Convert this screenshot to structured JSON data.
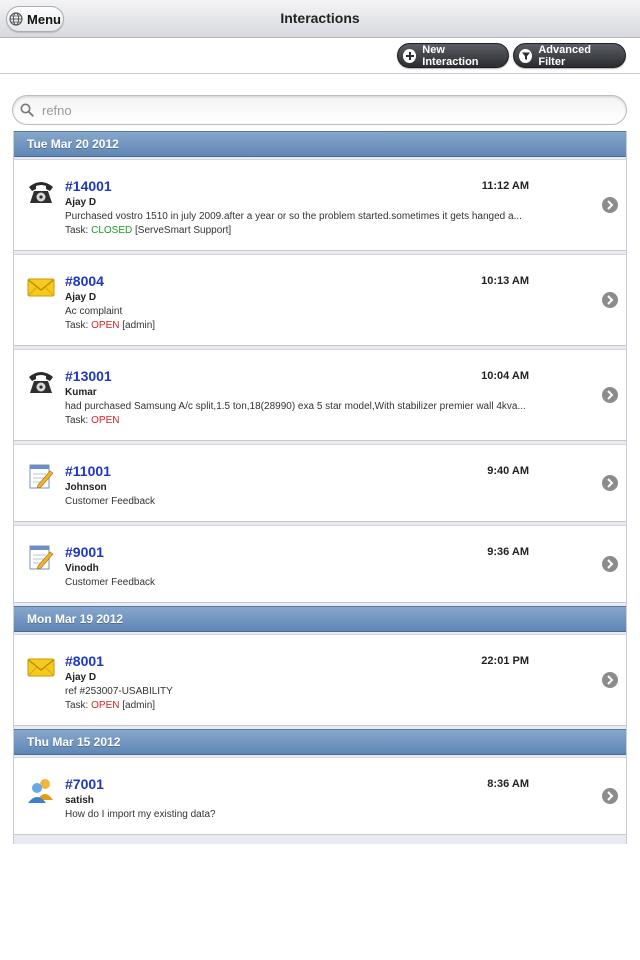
{
  "header": {
    "menu_label": "Menu",
    "title": "Interactions"
  },
  "toolbar": {
    "new_label": "New Interaction",
    "filter_label": "Advanced Filter"
  },
  "search": {
    "placeholder": "refno",
    "value": ""
  },
  "colors": {
    "accent": "#1f36c2",
    "closed": "#1b9a28",
    "open": "#e01e1e",
    "header_blue": "#6b8fbd"
  },
  "groups": [
    {
      "date": "Tue Mar 20 2012",
      "items": [
        {
          "icon": "phone-icon",
          "id": "#14001",
          "time": "11:12 AM",
          "name": "Ajay D",
          "desc": "Purchased vostro 1510 in july 2009.after a year or so the problem started.sometimes it gets hanged a...",
          "task_prefix": "Task: ",
          "status": "CLOSED",
          "task_suffix": " [ServeSmart Support]"
        },
        {
          "icon": "envelope-icon",
          "id": "#8004",
          "time": "10:13 AM",
          "name": "Ajay D",
          "desc": "Ac complaint",
          "task_prefix": "Task: ",
          "status": "OPEN",
          "task_suffix": " [admin]"
        },
        {
          "icon": "phone-icon",
          "id": "#13001",
          "time": "10:04 AM",
          "name": "Kumar",
          "desc": "had purchased Samsung A/c split,1.5 ton,18(28990) exa 5 star model,With stabilizer premier wall 4kva...",
          "task_prefix": "Task: ",
          "status": "OPEN",
          "task_suffix": ""
        },
        {
          "icon": "note-icon",
          "id": "#11001",
          "time": "9:40 AM",
          "name": "Johnson",
          "desc": "Customer Feedback"
        },
        {
          "icon": "note-icon",
          "id": "#9001",
          "time": "9:36 AM",
          "name": "Vinodh",
          "desc": "Customer Feedback"
        }
      ]
    },
    {
      "date": "Mon Mar 19 2012",
      "items": [
        {
          "icon": "envelope-icon",
          "id": "#8001",
          "time": "22:01 PM",
          "name": "Ajay D",
          "desc": "ref #253007-USABILITY",
          "task_prefix": "Task: ",
          "status": "OPEN",
          "task_suffix": " [admin]"
        }
      ]
    },
    {
      "date": "Thu Mar 15 2012",
      "items": [
        {
          "icon": "users-icon",
          "id": "#7001",
          "time": "8:36 AM",
          "name": "satish",
          "desc": "How do I import my existing data?"
        }
      ]
    }
  ]
}
